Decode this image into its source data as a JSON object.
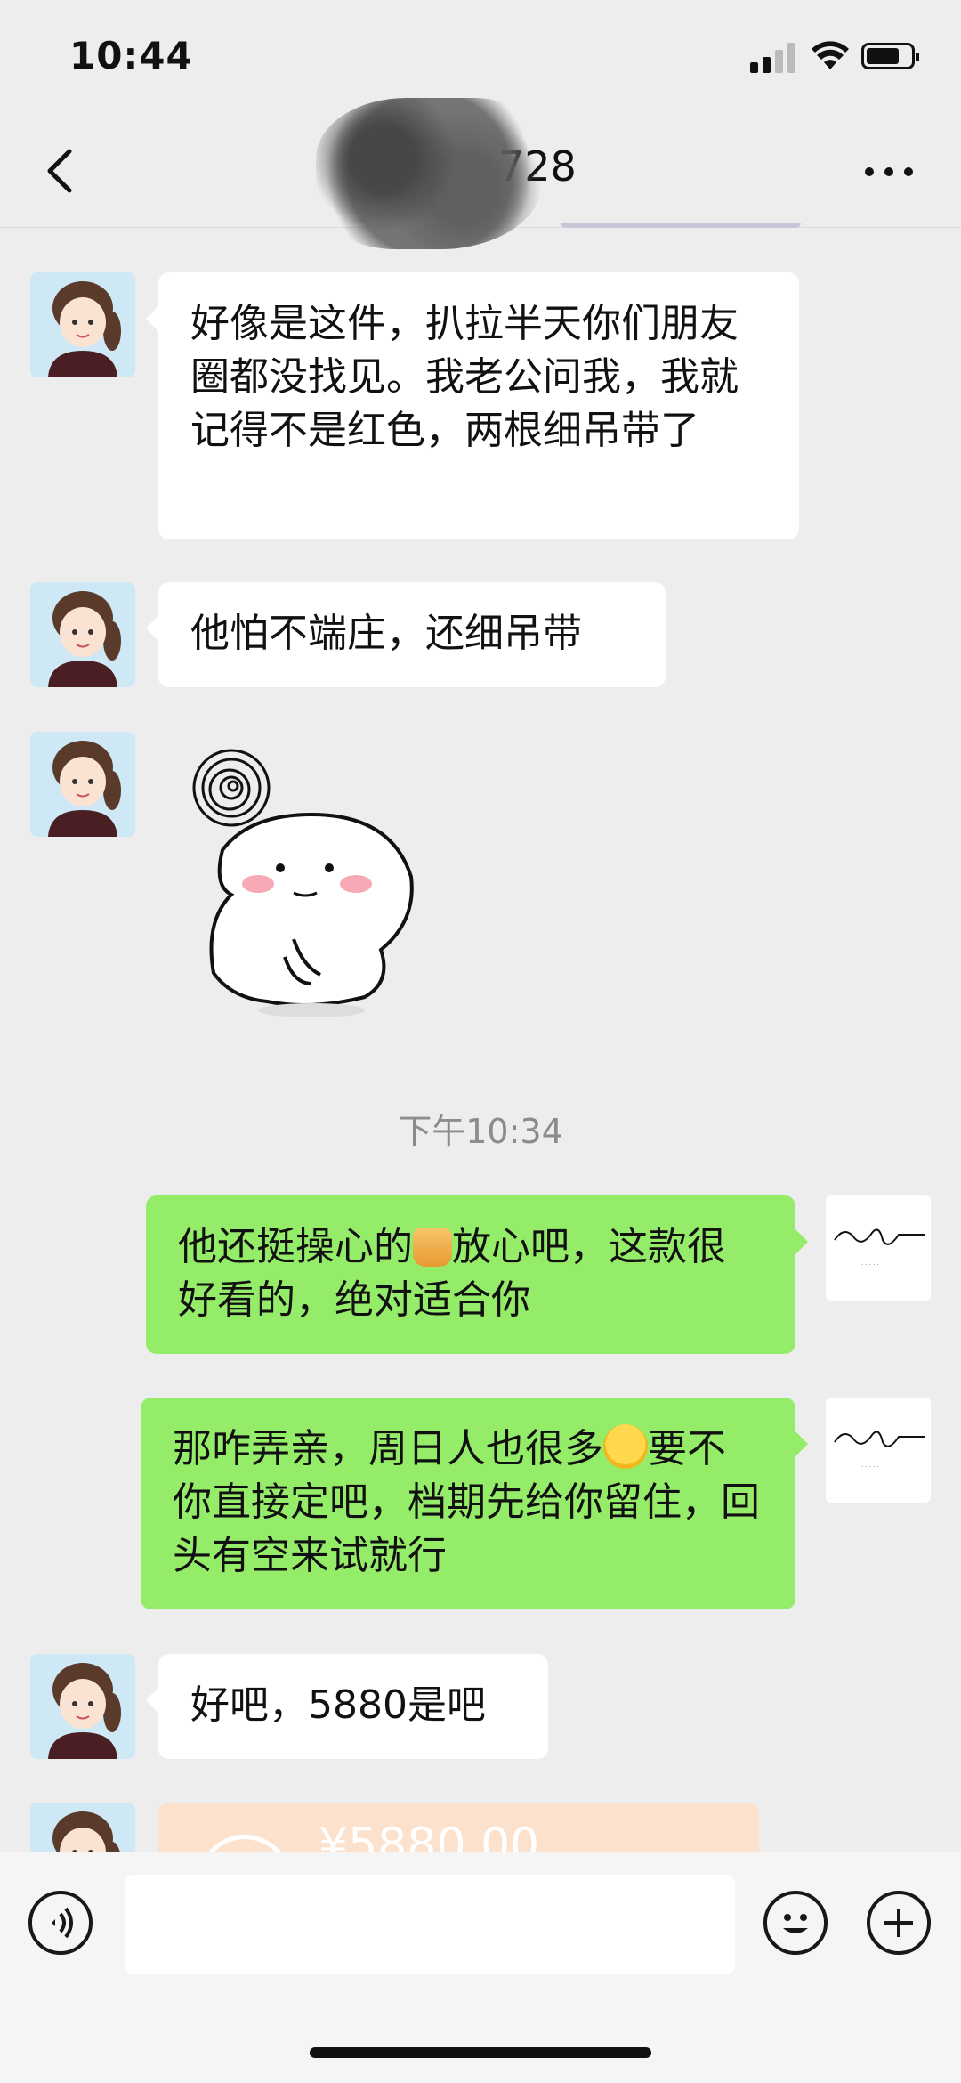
{
  "status_bar": {
    "time": "10:44"
  },
  "nav": {
    "title": "728"
  },
  "messages": {
    "m1": "好像是这件，扒拉半天你们朋友圈都没找见。我老公问我，我就记得不是红色，两根细吊带了",
    "m2": "他怕不端庄，还细吊带",
    "timestamp": "下午10:34",
    "m4_a": "他还挺操心的",
    "m4_b": "放心吧，这款很好看的，绝对适合你",
    "m5_a": "那咋弄亲，周日人也很多",
    "m5_b": "要不你直接定吧，档期先给你留住，回头有空来试就行",
    "m6": "好吧，5880是吧",
    "transfer_amount": "¥5880.00"
  },
  "colors": {
    "background": "#ededed",
    "bubble_out": "#95ec69",
    "bubble_in": "#ffffff",
    "transfer": "#fce1cc"
  },
  "input_bar": {
    "value": "",
    "placeholder": ""
  }
}
